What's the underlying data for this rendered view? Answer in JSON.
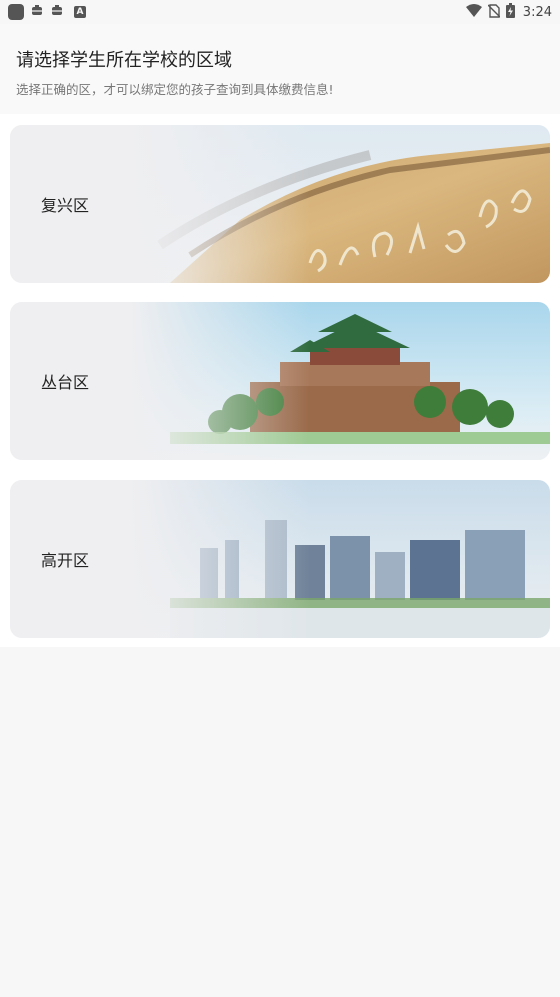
{
  "status_bar": {
    "time": "3:24",
    "left_icons": [
      "app-square-icon",
      "bug-icon",
      "bug-icon",
      "a-badge-icon"
    ],
    "right_icons": [
      "wifi-icon",
      "no-sim-icon",
      "battery-charging-icon"
    ]
  },
  "header": {
    "title": "请选择学生所在学校的区域",
    "subtitle": "选择正确的区，才可以绑定您的孩子查询到具体缴费信息!"
  },
  "regions": [
    {
      "label": "复兴区",
      "scene": "calligraphy-stone"
    },
    {
      "label": "丛台区",
      "scene": "ancient-pavilion-platform"
    },
    {
      "label": "高开区",
      "scene": "city-skyline"
    }
  ],
  "colors": {
    "background": "#f7f7f7",
    "card": "#efeff1",
    "title": "#222222",
    "subtitle": "#777777"
  }
}
